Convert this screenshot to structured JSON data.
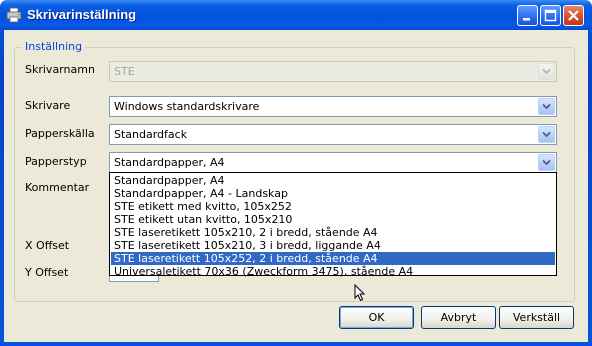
{
  "window": {
    "title": "Skrivarinställning"
  },
  "group": {
    "title": "Inställning"
  },
  "fields": {
    "printer_name": {
      "label": "Skrivarnamn",
      "value": "STE"
    },
    "printer": {
      "label": "Skrivare",
      "value": "Windows standardskrivare"
    },
    "paper_source": {
      "label": "Papperskälla",
      "value": "Standardfack"
    },
    "paper_type": {
      "label": "Papperstyp",
      "value": "Standardpapper, A4"
    },
    "comment": {
      "label": "Kommentar"
    },
    "x_offset": {
      "label": "X Offset"
    },
    "y_offset": {
      "label": "Y Offset"
    }
  },
  "paper_type_options": [
    "Standardpapper, A4",
    "Standardpapper, A4 - Landskap",
    "STE etikett med kvitto, 105x252",
    "STE etikett utan kvitto, 105x210",
    "STE laseretikett 105x210, 2 i bredd, stående A4",
    "STE laseretikett 105x210, 3 i bredd, liggande A4",
    "STE laseretikett 105x252, 2 i bredd, stående A4",
    "Universaletikett 70x36 (Zweckform 3475), stående A4"
  ],
  "paper_type_selected_index": 6,
  "buttons": {
    "ok": "OK",
    "cancel": "Avbryt",
    "apply": "Verkställ"
  },
  "colors": {
    "titlebar": "#0a5fe4",
    "selection": "#316ac5",
    "group_title": "#0046d5",
    "client": "#ece9d8"
  },
  "icons": {
    "app": "printer-icon",
    "minimize": "minimize-icon",
    "maximize": "maximize-icon",
    "close": "close-icon"
  }
}
